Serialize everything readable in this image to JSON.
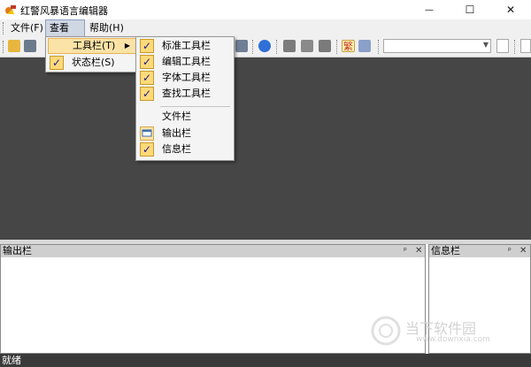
{
  "window": {
    "title": "红警风暴语言编辑器"
  },
  "menubar": {
    "items": [
      {
        "label": "文件(F)"
      },
      {
        "label": "查看(V)"
      },
      {
        "label": "帮助(H)"
      }
    ]
  },
  "view_menu": {
    "items": [
      {
        "label": "工具栏(T)",
        "has_submenu": true,
        "highlighted": true
      },
      {
        "label": "状态栏(S)",
        "checked": true
      }
    ]
  },
  "toolbar_submenu": {
    "items": [
      {
        "label": "标准工具栏",
        "checked": true
      },
      {
        "label": "编辑工具栏",
        "checked": true
      },
      {
        "label": "字体工具栏",
        "checked": true
      },
      {
        "label": "查找工具栏",
        "checked": true
      },
      {
        "label": "文件栏",
        "checked": false
      },
      {
        "label": "输出栏",
        "icon": "output-window-icon"
      },
      {
        "label": "信息栏",
        "checked": true
      }
    ]
  },
  "toolbar": {
    "traditional_glyph": "繁",
    "combo_value": ""
  },
  "panels": {
    "output": {
      "title": "输出栏",
      "pin": "ᵖ",
      "close": "✕"
    },
    "info": {
      "title": "信息栏",
      "pin": "ᵖ",
      "close": "✕"
    }
  },
  "status": {
    "text": "就绪"
  },
  "watermark": {
    "text": "当下软件园",
    "url": "www.downxia.com"
  },
  "window_controls": {
    "minimize": "—",
    "maximize": "☐",
    "close": "✕"
  },
  "colors": {
    "editor_bg": "#464646",
    "highlight": "#fbe2a6",
    "check_bg": "#ffd97a"
  }
}
